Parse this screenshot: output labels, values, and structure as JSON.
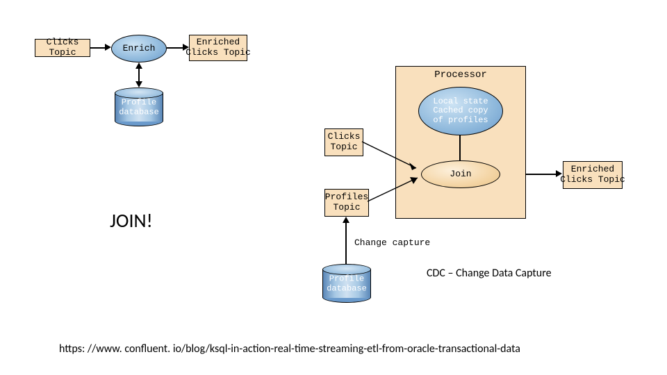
{
  "left": {
    "clicks": "Clicks Topic",
    "enrich": "Enrich",
    "enriched": "Enriched\nClicks Topic",
    "profile_db": "Profile\ndatabase"
  },
  "right": {
    "processor": "Processor",
    "local_state": "Local state\nCached copy\nof profiles",
    "join": "Join",
    "clicks": "Clicks\nTopic",
    "profiles": "Profiles\nTopic",
    "enriched": "Enriched\nClicks Topic",
    "change_capture": "Change capture",
    "profile_db": "Profile\ndatabase"
  },
  "text": {
    "join": "JOIN!",
    "cdc": "CDC – Change Data Capture",
    "url": "https: //www. confluent. io/blog/ksql-in-action-real-time-streaming-etl-from-oracle-transactional-data"
  }
}
